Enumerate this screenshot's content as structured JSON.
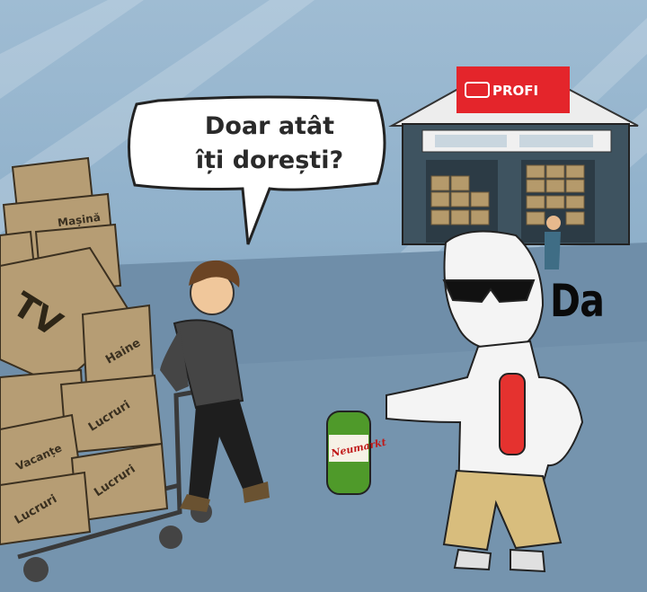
{
  "speech_bubble": {
    "line1": "Doar atât",
    "line2": "îți dorești?"
  },
  "reply": "Da",
  "store": {
    "sign": "PROFI",
    "sign_color": "#e4252b"
  },
  "boxes": {
    "masina": "Mașină",
    "tv": "TV",
    "haine": "Haine",
    "lucruri_1": "Lucruri",
    "vacante": "Vacanțe",
    "lucruri_2": "Lucruri",
    "lucruri_3": "Lucruri"
  },
  "bottle_label": "Neumarkt"
}
